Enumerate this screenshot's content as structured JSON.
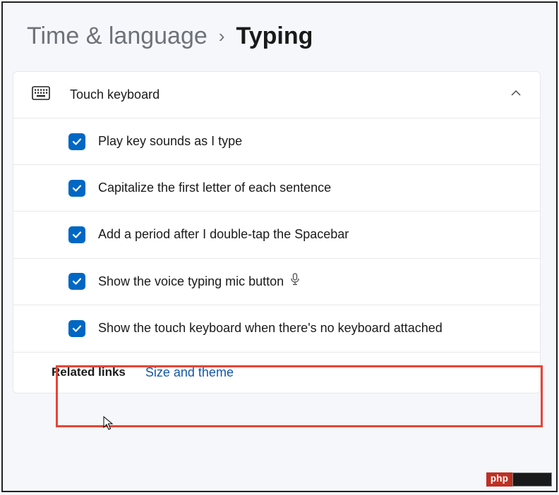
{
  "breadcrumb": {
    "parent": "Time & language",
    "separator": "›",
    "current": "Typing"
  },
  "section": {
    "title": "Touch keyboard"
  },
  "options": [
    {
      "label": "Play key sounds as I type",
      "checked": true,
      "hasMic": false
    },
    {
      "label": "Capitalize the first letter of each sentence",
      "checked": true,
      "hasMic": false
    },
    {
      "label": "Add a period after I double-tap the Spacebar",
      "checked": true,
      "hasMic": false
    },
    {
      "label": "Show the voice typing mic button",
      "checked": true,
      "hasMic": true
    },
    {
      "label": "Show the touch keyboard when there's no keyboard attached",
      "checked": true,
      "hasMic": false
    }
  ],
  "related": {
    "label": "Related links",
    "link": "Size and theme"
  },
  "watermark": {
    "text": "php"
  }
}
